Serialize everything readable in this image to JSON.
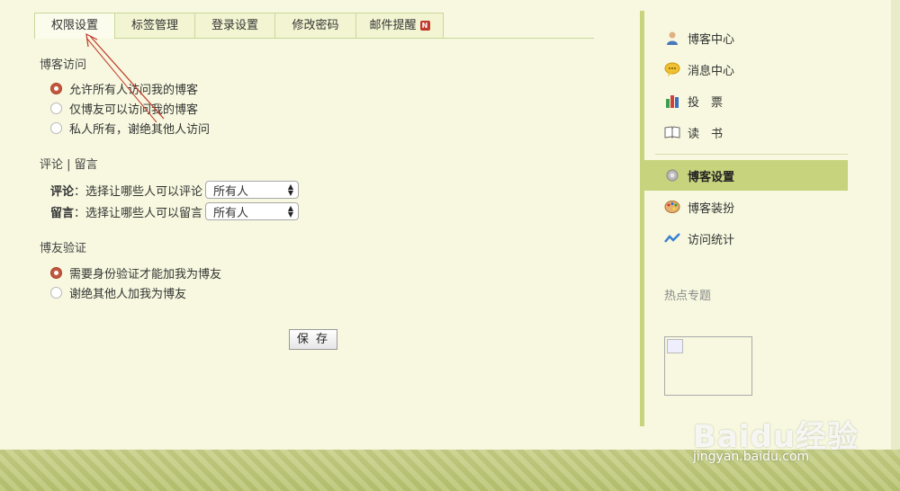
{
  "tabs": [
    {
      "label": "权限设置",
      "active": true
    },
    {
      "label": "标签管理",
      "active": false
    },
    {
      "label": "登录设置",
      "active": false
    },
    {
      "label": "修改密码",
      "active": false
    },
    {
      "label": "邮件提醒",
      "active": false,
      "badge": "N"
    }
  ],
  "blog_access": {
    "title": "博客访问",
    "options": [
      {
        "label": "允许所有人访问我的博客",
        "checked": true
      },
      {
        "label": "仅博友可以访问我的博客",
        "checked": false
      },
      {
        "label": "私人所有，谢绝其他人访问",
        "checked": false
      }
    ]
  },
  "comments": {
    "title": "评论 | 留言",
    "rows": [
      {
        "key": "评论",
        "desc": "：选择让哪些人可以评论",
        "value": "所有人"
      },
      {
        "key": "留言",
        "desc": "：选择让哪些人可以留言",
        "value": "所有人"
      }
    ]
  },
  "friend_verify": {
    "title": "博友验证",
    "options": [
      {
        "label": "需要身份验证才能加我为博友",
        "checked": true
      },
      {
        "label": "谢绝其他人加我为博友",
        "checked": false
      }
    ]
  },
  "save_label": "保 存",
  "sidebar": {
    "items": [
      {
        "label": "博客中心",
        "icon": "person-icon"
      },
      {
        "label": "消息中心",
        "icon": "speech-bubble-icon"
      },
      {
        "label": "投　票",
        "icon": "bar-chart-icon"
      },
      {
        "label": "读　书",
        "icon": "book-icon"
      },
      {
        "label": "博客设置",
        "icon": "gear-icon",
        "active": true
      },
      {
        "label": "博客装扮",
        "icon": "palette-icon"
      },
      {
        "label": "访问统计",
        "icon": "trend-icon"
      }
    ],
    "hot_title": "热点专题"
  },
  "watermark": {
    "logo": "Baidu经验",
    "site": "jingyan.baidu.com"
  },
  "colors": {
    "background": "#f7f8df",
    "accent": "#c7d37d",
    "radio_checked": "#c4563f",
    "annotation_arrow": "#c0392b"
  }
}
